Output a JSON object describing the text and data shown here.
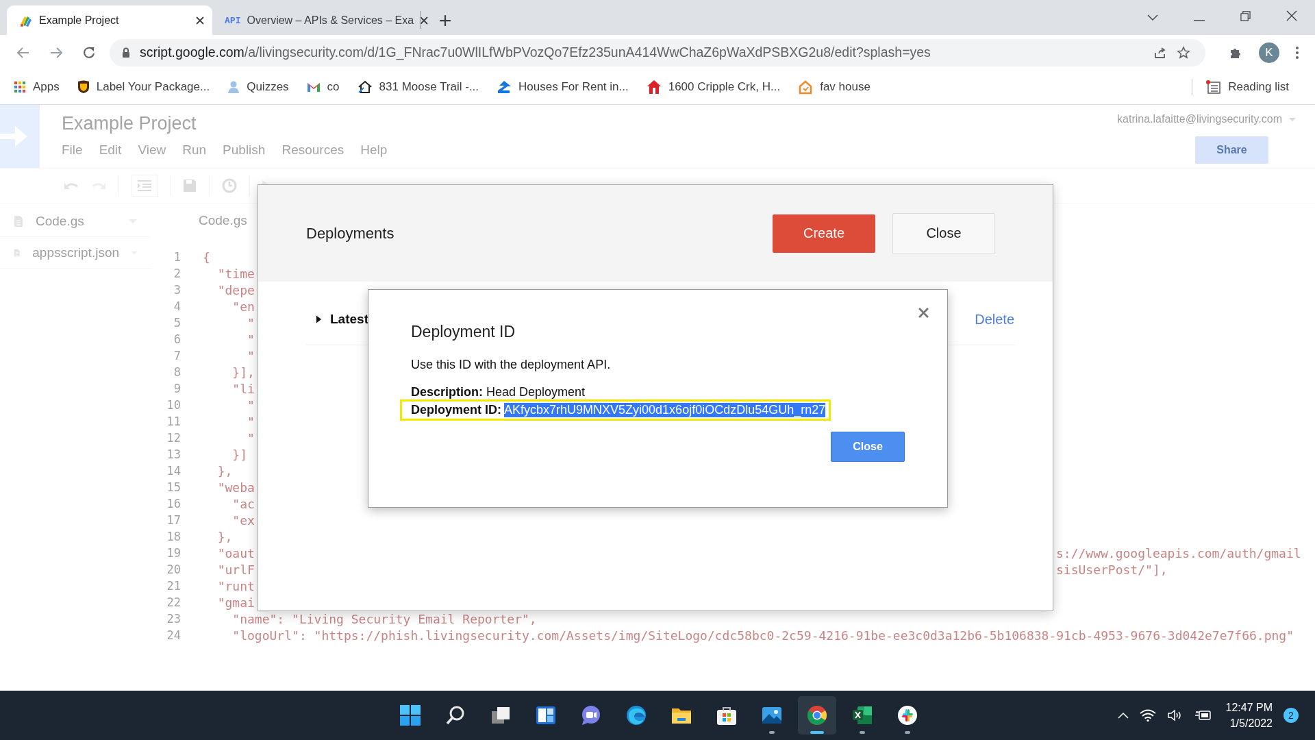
{
  "browser": {
    "tabs": [
      {
        "title": "Example Project",
        "selected": true
      },
      {
        "title": "Overview – APIs & Services – Exa",
        "favicon_text": "API",
        "selected": false
      }
    ],
    "url": {
      "host": "script.google.com",
      "path": "/a/livingsecurity.com/d/1G_FNrac7u0WlILfWbPVozQo7Efz235unA414WwChaZ6pWaXdPSBXG2u8/edit?splash=yes"
    },
    "profile_initial": "K",
    "bookmarks": [
      {
        "kind": "grid",
        "label": "Apps"
      },
      {
        "kind": "shield",
        "label": "Label Your Package..."
      },
      {
        "kind": "person",
        "label": "Quizzes"
      },
      {
        "kind": "mail",
        "label": "co"
      },
      {
        "kind": "house-key",
        "label": "831 Moose Trail -..."
      },
      {
        "kind": "z-house",
        "label": "Houses For Rent in..."
      },
      {
        "kind": "red-house",
        "label": "1600 Cripple Crk, H..."
      },
      {
        "kind": "orange-house",
        "label": "fav house"
      }
    ],
    "reading_list": "Reading list"
  },
  "editor": {
    "project_title": "Example Project",
    "menu": [
      "File",
      "Edit",
      "View",
      "Run",
      "Publish",
      "Resources",
      "Help"
    ],
    "account": "katrina.lafaitte@livingsecurity.com",
    "share": "Share",
    "files": [
      {
        "name": "Code.gs"
      },
      {
        "name": "appsscript.json"
      }
    ],
    "open_tab": "Code.gs",
    "code_lines": [
      {
        "number": "1",
        "text": "{"
      },
      {
        "number": "2",
        "text": "  \"time"
      },
      {
        "number": "3",
        "text": "  \"depe"
      },
      {
        "number": "4",
        "text": "    \"en"
      },
      {
        "number": "5",
        "text": "      \""
      },
      {
        "number": "6",
        "text": "      \""
      },
      {
        "number": "7",
        "text": "      \""
      },
      {
        "number": "8",
        "text": "    }],"
      },
      {
        "number": "9",
        "text": "    \"li"
      },
      {
        "number": "10",
        "text": "      \""
      },
      {
        "number": "11",
        "text": "      \""
      },
      {
        "number": "12",
        "text": "      \""
      },
      {
        "number": "13",
        "text": "    }]"
      },
      {
        "number": "14",
        "text": "  },"
      },
      {
        "number": "15",
        "text": "  \"weba"
      },
      {
        "number": "16",
        "text": "    \"ac"
      },
      {
        "number": "17",
        "text": "    \"ex"
      },
      {
        "number": "18",
        "text": "  },"
      },
      {
        "number": "19",
        "text": "  \"oaut",
        "tail": "s://www.googleapis.com/auth/gmail"
      },
      {
        "number": "20",
        "text": "  \"urlF",
        "tail": "sisUserPost/\"],"
      },
      {
        "number": "21",
        "text": "  \"runt"
      },
      {
        "number": "22",
        "text": "  \"gmai"
      },
      {
        "number": "23",
        "text": "    \"name\": \"Living Security Email Reporter\","
      },
      {
        "number": "24",
        "text": "    \"logoUrl\": \"https://phish.livingsecurity.com/Assets/img/SiteLogo/cdc58bc0-2c59-4216-91be-ee3c0d3a12b6-5b106838-91cb-4953-9676-3d042e7e7f66.png\""
      }
    ]
  },
  "deployments_dialog": {
    "title": "Deployments",
    "create": "Create",
    "close": "Close",
    "row": {
      "label": "Latest",
      "expanded": false,
      "action": "Delete"
    }
  },
  "deployment_id_dialog": {
    "title": "Deployment ID",
    "intro": "Use this ID with the deployment API.",
    "description": "**Description:** Head Deployment",
    "id_label": "Deployment ID:",
    "id": "AKfycbx7rhU9MNXV5Zyi00d1x6ojf0iOCdzDlu54GUh_rn27",
    "id_selected": true,
    "close": "Close"
  },
  "taskbar": {
    "apps": [
      {
        "kind": "start",
        "running": false,
        "selected": false
      },
      {
        "kind": "search",
        "running": false,
        "selected": false
      },
      {
        "kind": "task-view",
        "running": false,
        "selected": false
      },
      {
        "kind": "widgets",
        "running": false,
        "selected": false
      },
      {
        "kind": "chat",
        "running": false,
        "selected": false
      },
      {
        "kind": "edge",
        "running": false,
        "selected": false
      },
      {
        "kind": "folder",
        "running": false,
        "selected": false
      },
      {
        "kind": "store",
        "running": false,
        "selected": false
      },
      {
        "kind": "photos",
        "running": true,
        "selected": false
      },
      {
        "kind": "chrome",
        "running": true,
        "selected": true
      },
      {
        "kind": "excel",
        "running": true,
        "selected": false
      },
      {
        "kind": "slack",
        "running": true,
        "selected": false
      }
    ],
    "time": "12:47 PM",
    "date": "1/5/2022",
    "notifications": "2"
  }
}
